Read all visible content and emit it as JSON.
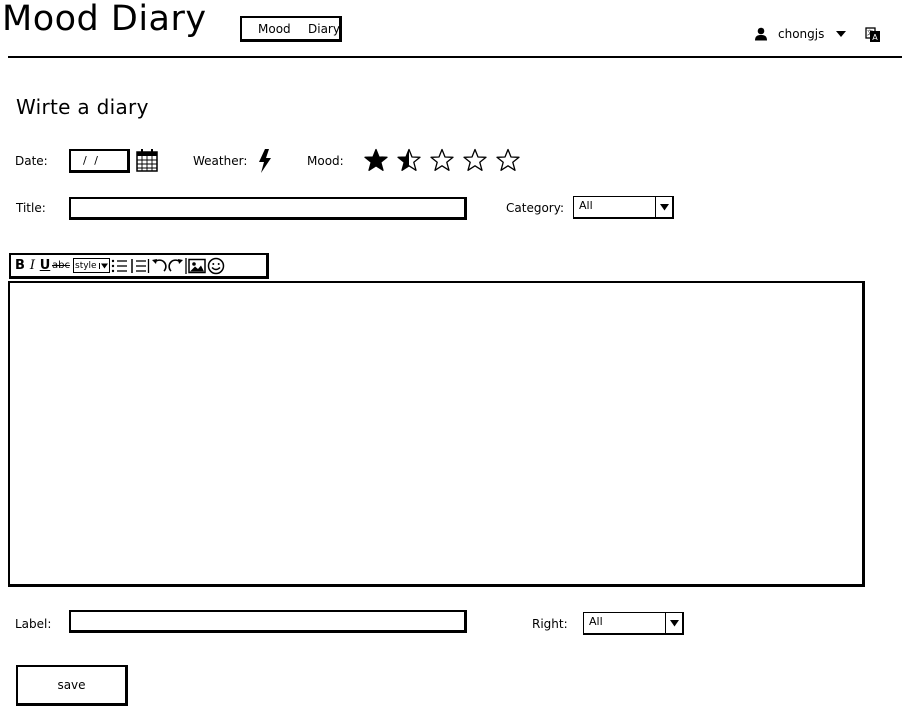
{
  "header": {
    "app_title": "Mood Diary",
    "nav_items": [
      "Mood",
      "Diary"
    ],
    "username": "chongjs"
  },
  "page": {
    "title": "Wirte a diary"
  },
  "form": {
    "date_label": "Date:",
    "date_value": "/ /",
    "weather_label": "Weather:",
    "weather_icon": "lightning-icon",
    "mood_label": "Mood:",
    "mood_rating": 1.5,
    "mood_max": 5,
    "title_label": "Title:",
    "title_value": "",
    "category_label": "Category:",
    "category_value": "All",
    "toolbar_style_label": "style",
    "label_label": "Label:",
    "label_value": "",
    "right_label": "Right:",
    "right_value": "All",
    "save_label": "save"
  }
}
